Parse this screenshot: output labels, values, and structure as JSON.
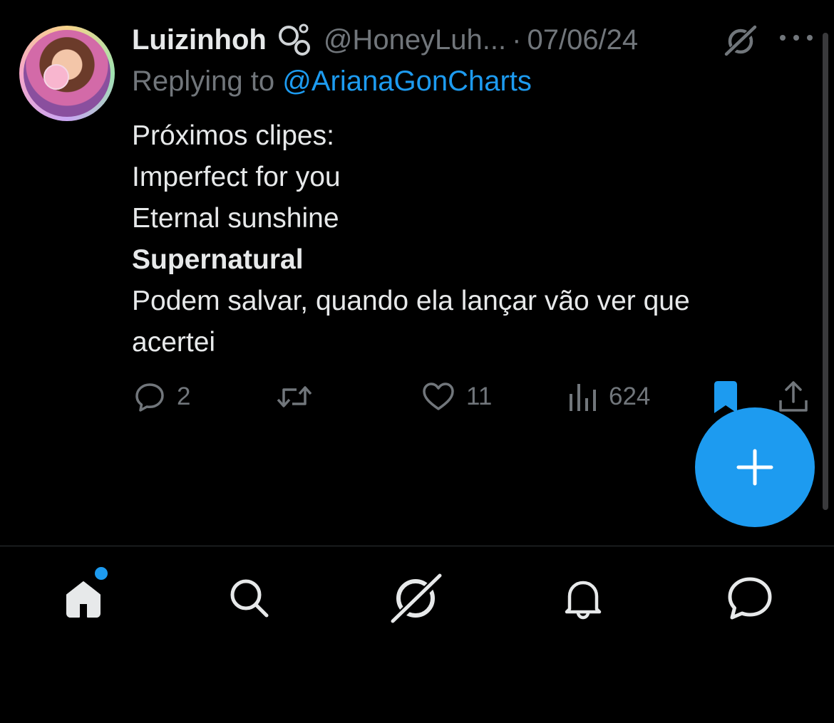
{
  "tweet": {
    "author": {
      "display_name": "Luizinhoh",
      "handle": "@HoneyLuh...",
      "separator": "·",
      "date": "07/06/24"
    },
    "replying_prefix": "Replying to ",
    "replying_to": "@ArianaGonCharts",
    "body_lines": [
      "Próximos clipes:",
      "Imperfect for you",
      "Eternal sunshine",
      "Supernatural",
      "Podem salvar, quando ela lançar vão ver que",
      "acertei"
    ],
    "bold_line_index": 3,
    "stats": {
      "replies": "2",
      "retweets": "",
      "likes": "11",
      "views": "624"
    }
  },
  "icons": {
    "header": [
      "bubbles-icon",
      "grok-icon",
      "more-icon"
    ],
    "actions": [
      "reply-icon",
      "retweet-icon",
      "like-icon",
      "views-icon",
      "bookmark-icon",
      "share-icon"
    ],
    "tabbar": [
      "home-icon",
      "search-icon",
      "grok-icon",
      "notifications-icon",
      "messages-icon"
    ],
    "fab": "plus-icon"
  },
  "colors": {
    "background": "#000000",
    "text_primary": "#e7e9ea",
    "text_secondary": "#71767b",
    "accent": "#1d9bf0"
  }
}
